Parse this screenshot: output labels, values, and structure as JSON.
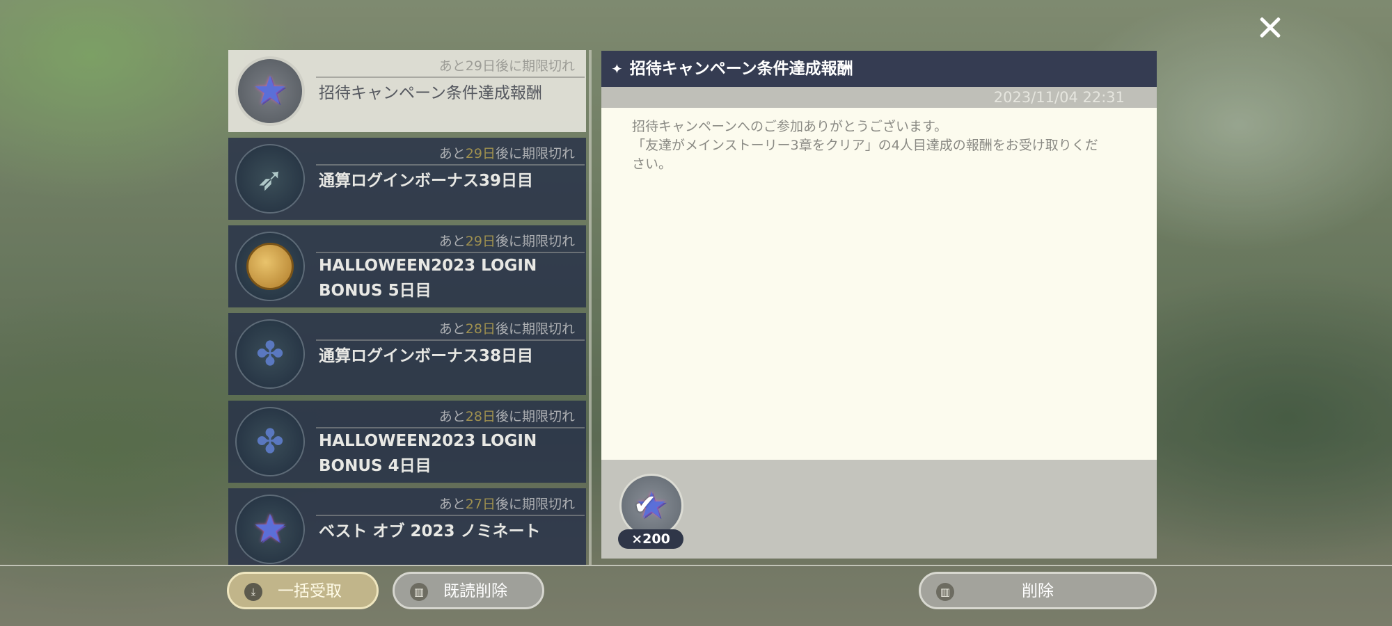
{
  "close_button": {
    "icon": "close-icon"
  },
  "mail_list": {
    "items": [
      {
        "expiry_prefix": "あと",
        "expiry_days": "29日",
        "expiry_suffix": "後に期限切れ",
        "title_line1": "招待キャンペーン条件達成報酬",
        "title_line2": "",
        "icon": "star-icon",
        "selected": true
      },
      {
        "expiry_prefix": "あと",
        "expiry_days": "29日",
        "expiry_suffix": "後に期限切れ",
        "title_line1": "通算ログインボーナス39日目",
        "title_line2": "",
        "icon": "feather-icon",
        "selected": false
      },
      {
        "expiry_prefix": "あと",
        "expiry_days": "29日",
        "expiry_suffix": "後に期限切れ",
        "title_line1": "HALLOWEEN2023 LOGIN",
        "title_line2": "BONUS 5日目",
        "icon": "coin-icon",
        "selected": false
      },
      {
        "expiry_prefix": "あと",
        "expiry_days": "28日",
        "expiry_suffix": "後に期限切れ",
        "title_line1": "通算ログインボーナス38日目",
        "title_line2": "",
        "icon": "candy-icon",
        "selected": false
      },
      {
        "expiry_prefix": "あと",
        "expiry_days": "28日",
        "expiry_suffix": "後に期限切れ",
        "title_line1": "HALLOWEEN2023 LOGIN",
        "title_line2": "BONUS 4日目",
        "icon": "candy-icon",
        "selected": false
      },
      {
        "expiry_prefix": "あと",
        "expiry_days": "27日",
        "expiry_suffix": "後に期限切れ",
        "title_line1": "ベスト オブ 2023 ノミネート",
        "title_line2": "",
        "icon": "star-icon",
        "selected": false
      }
    ]
  },
  "detail": {
    "title_icon": "sparkle-icon",
    "title": "招待キャンペーン条件達成報酬",
    "date": "2023/11/04 22:31",
    "body_line1": "招待キャンペーンへのご参加ありがとうございます。",
    "body_line2": "「友達がメインストーリー3章をクリア」の4人目達成の報酬をお受け取りください。",
    "reward": {
      "icon": "star-icon",
      "claimed": true,
      "quantity": "×200"
    }
  },
  "buttons": {
    "receive_all": {
      "label": "一括受取",
      "icon": "download-icon"
    },
    "delete_read": {
      "label": "既読削除",
      "icon": "trash-icon"
    },
    "delete": {
      "label": "削除",
      "icon": "trash-icon"
    }
  }
}
